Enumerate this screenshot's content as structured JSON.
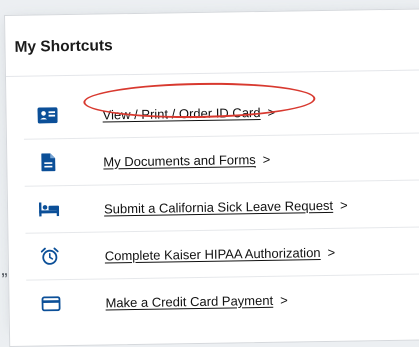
{
  "background_mark": "„",
  "card": {
    "title": "My Shortcuts"
  },
  "shortcuts": [
    {
      "label": "View / Print / Order ID Card",
      "chevron": ">",
      "icon": "id-card-icon"
    },
    {
      "label": "My Documents and Forms",
      "chevron": ">",
      "icon": "document-icon"
    },
    {
      "label": "Submit a California Sick Leave Request",
      "chevron": ">",
      "icon": "bed-icon"
    },
    {
      "label": "Complete Kaiser HIPAA Authorization",
      "chevron": ">",
      "icon": "alarm-clock-icon"
    },
    {
      "label": "Make a Credit Card Payment",
      "chevron": ">",
      "icon": "credit-card-icon"
    }
  ],
  "colors": {
    "icon": "#0b4f98",
    "annotation": "#d8392f",
    "text": "#111111"
  },
  "annotation": {
    "circled_item": "View / Print / Order ID Card"
  }
}
